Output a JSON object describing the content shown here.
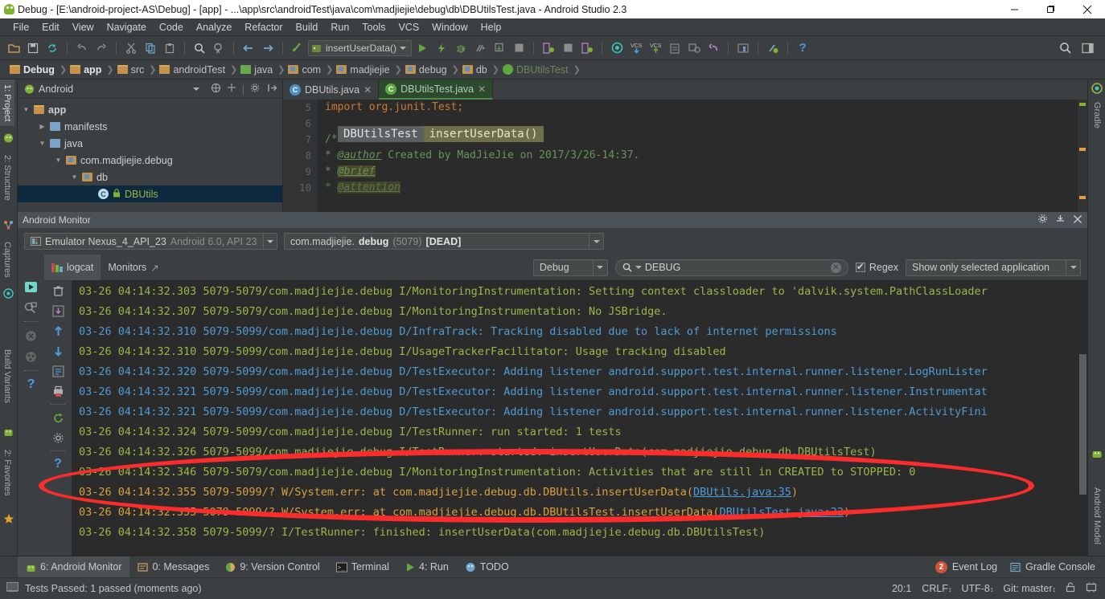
{
  "window": {
    "title": "Debug - [E:\\android-project-AS\\Debug] - [app] - ...\\app\\src\\androidTest\\java\\com\\madjiejie\\debug\\db\\DBUtilsTest.java - Android Studio 2.3",
    "minimize": "–",
    "maximize": "❐",
    "close": "✕"
  },
  "menubar": [
    {
      "label": "File"
    },
    {
      "label": "Edit"
    },
    {
      "label": "View"
    },
    {
      "label": "Navigate"
    },
    {
      "label": "Code"
    },
    {
      "label": "Analyze"
    },
    {
      "label": "Refactor"
    },
    {
      "label": "Build"
    },
    {
      "label": "Run"
    },
    {
      "label": "Tools"
    },
    {
      "label": "VCS"
    },
    {
      "label": "Window"
    },
    {
      "label": "Help"
    }
  ],
  "toolbar": {
    "run_configuration": "insertUserData()",
    "help_icon": "?"
  },
  "breadcrumb": [
    {
      "label": "Debug",
      "icon": "module-icon"
    },
    {
      "label": "app",
      "icon": "module-icon"
    },
    {
      "label": "src",
      "icon": "folder-icon"
    },
    {
      "label": "androidTest",
      "icon": "folder-icon"
    },
    {
      "label": "java",
      "icon": "folder-green-icon"
    },
    {
      "label": "com",
      "icon": "package-icon"
    },
    {
      "label": "madjiejie",
      "icon": "package-icon"
    },
    {
      "label": "debug",
      "icon": "package-icon"
    },
    {
      "label": "db",
      "icon": "package-icon"
    },
    {
      "label": "DBUtilsTest",
      "icon": "test-class-icon"
    }
  ],
  "left_tool_strip": [
    {
      "label": "1: Project",
      "active": true
    },
    {
      "label": "2: Structure",
      "active": false
    },
    {
      "label": "Captures",
      "active": false
    },
    {
      "label": "Build Variants",
      "active": false
    },
    {
      "label": "2: Favorites",
      "active": false
    }
  ],
  "right_tool_strip": [
    {
      "label": "Gradle"
    },
    {
      "label": "Android Model"
    }
  ],
  "project": {
    "selector": "Android",
    "tree": [
      {
        "label": "app",
        "depth": 0,
        "twisty": "down",
        "icon": "module-icon",
        "bold": true,
        "selected": false
      },
      {
        "label": "manifests",
        "depth": 1,
        "twisty": "right",
        "icon": "folder-blue-icon",
        "bold": false,
        "selected": false
      },
      {
        "label": "java",
        "depth": 1,
        "twisty": "down",
        "icon": "folder-blue-icon",
        "bold": false,
        "selected": false
      },
      {
        "label": "com.madjiejie.debug",
        "depth": 2,
        "twisty": "down",
        "icon": "package-icon",
        "bold": false,
        "selected": false
      },
      {
        "label": "db",
        "depth": 3,
        "twisty": "down",
        "icon": "package-icon",
        "bold": false,
        "selected": false
      },
      {
        "label": "DBUtils",
        "depth": 4,
        "twisty": "none",
        "icon": "class-icon",
        "bold": false,
        "selected": true
      }
    ]
  },
  "editor": {
    "tabs": [
      {
        "label": "DBUtils.java",
        "active": false,
        "icon": "java-class-icon"
      },
      {
        "label": "DBUtilsTest.java",
        "active": true,
        "icon": "java-test-class-icon"
      }
    ],
    "popup_breadcrumb": [
      "DBUtilsTest",
      "insertUserData()"
    ],
    "lines": [
      {
        "num": "5",
        "text": "import org.junit.Test;"
      },
      {
        "num": "6",
        "text": ""
      },
      {
        "num": "7",
        "text": "/**"
      },
      {
        "num": "8",
        "text": " * @author Created by MadJieJie on 2017/3/26-14:37."
      },
      {
        "num": "9",
        "text": " * @brief"
      },
      {
        "num": "10",
        "text": " * @attention"
      }
    ]
  },
  "monitor": {
    "title": "Android Monitor",
    "device": "Emulator Nexus_4_API_23",
    "device_detail": "Android 6.0, API 23",
    "process_name": "com.madjiejie.",
    "process_bold": "debug",
    "process_pid": "(5079)",
    "process_state": "[DEAD]",
    "tabs": [
      {
        "label": "logcat",
        "active": true
      },
      {
        "label": "Monitors",
        "active": false
      }
    ],
    "level_filter": "Debug",
    "search_value": "DEBUG",
    "search_placeholder": "DEBUG",
    "regex_label": "Regex",
    "regex_checked": true,
    "app_filter": "Show only selected application"
  },
  "logcat": [
    {
      "level": "info",
      "text": "03-26 04:14:32.303 5079-5079/com.madjiejie.debug I/MonitoringInstrumentation: Setting context classloader to 'dalvik.system.PathClassLoader"
    },
    {
      "level": "info",
      "text": "03-26 04:14:32.307 5079-5079/com.madjiejie.debug I/MonitoringInstrumentation: No JSBridge."
    },
    {
      "level": "debug",
      "text": "03-26 04:14:32.310 5079-5099/com.madjiejie.debug D/InfraTrack: Tracking disabled due to lack of internet permissions"
    },
    {
      "level": "info",
      "text": "03-26 04:14:32.310 5079-5099/com.madjiejie.debug I/UsageTrackerFacilitator: Usage tracking disabled"
    },
    {
      "level": "debug",
      "text": "03-26 04:14:32.320 5079-5099/com.madjiejie.debug D/TestExecutor: Adding listener android.support.test.internal.runner.listener.LogRunLister"
    },
    {
      "level": "debug",
      "text": "03-26 04:14:32.321 5079-5099/com.madjiejie.debug D/TestExecutor: Adding listener android.support.test.internal.runner.listener.Instrumentat"
    },
    {
      "level": "debug",
      "text": "03-26 04:14:32.321 5079-5099/com.madjiejie.debug D/TestExecutor: Adding listener android.support.test.internal.runner.listener.ActivityFini"
    },
    {
      "level": "info",
      "text": "03-26 04:14:32.324 5079-5099/com.madjiejie.debug I/TestRunner: run started: 1 tests"
    },
    {
      "level": "info",
      "text": "03-26 04:14:32.326 5079-5099/com.madjiejie.debug I/TestRunner: started: insertUserData(com.madjiejie.debug.db.DBUtilsTest)"
    },
    {
      "level": "info",
      "text": "03-26 04:14:32.346 5079-5079/com.madjiejie.debug I/MonitoringInstrumentation: Activities that are still in CREATED to STOPPED: 0"
    },
    {
      "level": "warn",
      "prefix": "03-26 04:14:32.355 5079-5099/? W/System.err:     at com.madjiejie.debug.db.DBUtils.insertUserData(",
      "link": "DBUtils.java:35",
      "suffix": ")"
    },
    {
      "level": "warn",
      "prefix": "03-26 04:14:32.355 5079-5099/? W/System.err:     at com.madjiejie.debug.db.DBUtilsTest.insertUserData(",
      "link": "DBUtilsTest.java:22",
      "suffix": ")"
    },
    {
      "level": "info",
      "text": "03-26 04:14:32.358 5079-5099/? I/TestRunner: finished: insertUserData(com.madjiejie.debug.db.DBUtilsTest)"
    }
  ],
  "annotation": {
    "shape": "red-ellipse",
    "color": "#fb2c2c"
  },
  "bottom_bar": {
    "items": [
      {
        "label": "6: Android Monitor",
        "icon": "android-icon",
        "active": true
      },
      {
        "label": "0: Messages",
        "icon": "messages-icon",
        "active": false
      },
      {
        "label": "9: Version Control",
        "icon": "vcs-icon",
        "active": false
      },
      {
        "label": "Terminal",
        "icon": "terminal-icon",
        "active": false
      },
      {
        "label": "4: Run",
        "icon": "run-icon",
        "active": false
      },
      {
        "label": "TODO",
        "icon": "todo-icon",
        "active": false
      }
    ],
    "event_log": "Event Log",
    "event_log_badge": "2",
    "gradle_console": "Gradle Console"
  },
  "status_bar": {
    "message": "Tests Passed: 1 passed (moments ago)",
    "caret_position": "20:1",
    "line_separator": "CRLF",
    "encoding": "UTF-8",
    "branch": "Git: master"
  },
  "colors": {
    "accent_red": "#fb2c2c",
    "log_info": "#9ab648",
    "log_debug": "#4e9bd4",
    "log_warn": "#d9a03c",
    "link": "#4a9edc",
    "panel_bg": "#3c3f41",
    "editor_bg": "#2b2b2b"
  }
}
